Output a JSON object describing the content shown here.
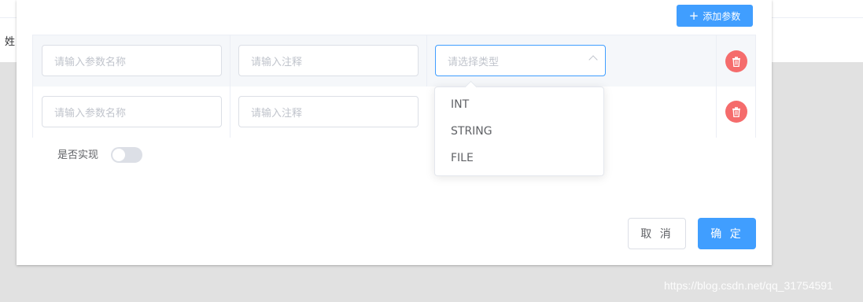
{
  "background": {
    "fragment_text": "姓"
  },
  "dialog": {
    "add_param_label": "添加参数",
    "rows": [
      {
        "name_placeholder": "请输入参数名称",
        "comment_placeholder": "请输入注释",
        "type_placeholder": "请选择类型"
      },
      {
        "name_placeholder": "请输入参数名称",
        "comment_placeholder": "请输入注释"
      }
    ],
    "type_options": [
      "INT",
      "STRING",
      "FILE"
    ],
    "switch_label": "是否实现",
    "switch_on": false,
    "cancel_label": "取 消",
    "confirm_label": "确 定"
  },
  "watermark": "https://blog.csdn.net/qq_31754591",
  "colors": {
    "primary": "#409eff",
    "danger": "#f56c6c"
  }
}
